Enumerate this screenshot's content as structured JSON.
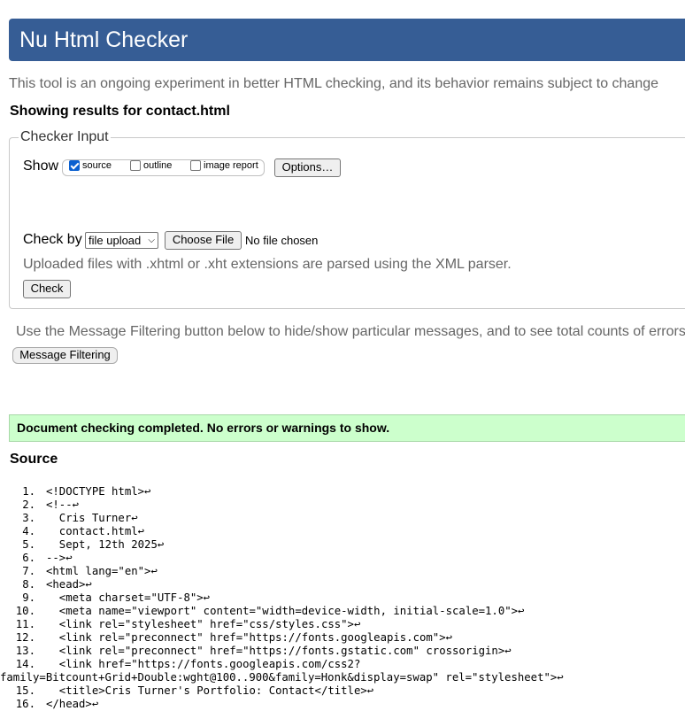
{
  "header": {
    "title": "Nu Html Checker"
  },
  "intro": "This tool is an ongoing experiment in better HTML checking, and its behavior remains subject to change",
  "showing": "Showing results for contact.html",
  "checker": {
    "legend": "Checker Input",
    "show_label": "Show",
    "options": [
      {
        "label": "source",
        "checked": true
      },
      {
        "label": "outline",
        "checked": false
      },
      {
        "label": "image report",
        "checked": false
      }
    ],
    "options_button": "Options…",
    "check_by_label": "Check by",
    "check_by_value": "file upload",
    "choose_file": "Choose File",
    "no_file": "No file chosen",
    "xml_note": "Uploaded files with .xhtml or .xht extensions are parsed using the XML parser.",
    "check_button": "Check"
  },
  "filter_note": "Use the Message Filtering button below to hide/show particular messages, and to see total counts of errors",
  "filter_button": "Message Filtering",
  "result": "Document checking completed. No errors or warnings to show.",
  "source_title": "Source",
  "source_lines": [
    {
      "n": "1.",
      "text": "<!DOCTYPE html>↩"
    },
    {
      "n": "2.",
      "text": "<!--↩"
    },
    {
      "n": "3.",
      "text": "  Cris Turner↩"
    },
    {
      "n": "4.",
      "text": "  contact.html↩"
    },
    {
      "n": "5.",
      "text": "  Sept, 12th 2025↩"
    },
    {
      "n": "6.",
      "text": "-->↩"
    },
    {
      "n": "7.",
      "text": "<html lang=\"en\">↩"
    },
    {
      "n": "8.",
      "text": "<head>↩"
    },
    {
      "n": "9.",
      "text": "  <meta charset=\"UTF-8\">↩"
    },
    {
      "n": "10.",
      "text": "  <meta name=\"viewport\" content=\"width=device-width, initial-scale=1.0\">↩"
    },
    {
      "n": "11.",
      "text": "  <link rel=\"stylesheet\" href=\"css/styles.css\">↩"
    },
    {
      "n": "12.",
      "text": "  <link rel=\"preconnect\" href=\"https://fonts.googleapis.com\">↩"
    },
    {
      "n": "13.",
      "text": "  <link rel=\"preconnect\" href=\"https://fonts.gstatic.com\" crossorigin>↩"
    },
    {
      "n": "14.",
      "text": "  <link href=\"https://fonts.googleapis.com/css2?",
      "wrap": "family=Bitcount+Grid+Double:wght@100..900&family=Honk&display=swap\" rel=\"stylesheet\">↩"
    },
    {
      "n": "15.",
      "text": "  <title>Cris Turner's Portfolio: Contact</title>↩"
    },
    {
      "n": "16.",
      "text": "</head>↩"
    }
  ]
}
